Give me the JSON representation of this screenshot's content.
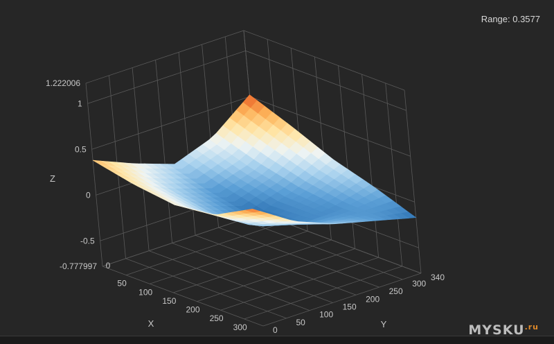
{
  "range": {
    "label": "Range: 0.3577"
  },
  "watermark": {
    "brand": "MYSKU",
    "suffix": ".ru"
  },
  "chart_data": {
    "type": "surface",
    "xlabel": "X",
    "ylabel": "Y",
    "zlabel": "Z",
    "xlim": [
      0,
      340
    ],
    "ylim": [
      0,
      340
    ],
    "zlim": [
      -0.777997,
      1.222006
    ],
    "x_ticks": [
      "50",
      "100",
      "150",
      "200",
      "250",
      "300"
    ],
    "x_tick_values": [
      50,
      100,
      150,
      200,
      250,
      300
    ],
    "y_ticks": [
      "0",
      "50",
      "100",
      "150",
      "200",
      "250",
      "300",
      "340"
    ],
    "y_tick_values": [
      0,
      50,
      100,
      150,
      200,
      250,
      300,
      340
    ],
    "z_ticks": [
      "-0.777997",
      "-0.5",
      "0",
      "0.5",
      "1",
      "1.222006"
    ],
    "z_tick_values": [
      -0.777997,
      -0.5,
      0,
      0.5,
      1,
      1.222006
    ],
    "x_origin_tick": "0",
    "surface": {
      "x": [
        0,
        85,
        170,
        255,
        340
      ],
      "y": [
        0,
        85,
        170,
        255,
        340
      ],
      "z": [
        [
          0.38,
          0.2,
          0.05,
          0.2,
          0.52
        ],
        [
          0.28,
          0.06,
          -0.08,
          0.05,
          0.34
        ],
        [
          0.22,
          -0.03,
          -0.18,
          -0.05,
          0.14
        ],
        [
          0.27,
          0.0,
          -0.12,
          -0.1,
          0.0
        ],
        [
          0.5,
          0.22,
          0.05,
          -0.06,
          -0.17
        ]
      ]
    },
    "colorscale": [
      "#2a6fb0",
      "#5b9fd6",
      "#a9d2ee",
      "#eef4f4",
      "#ffe6a8",
      "#fdb45a",
      "#e8571f"
    ],
    "grid": true
  }
}
